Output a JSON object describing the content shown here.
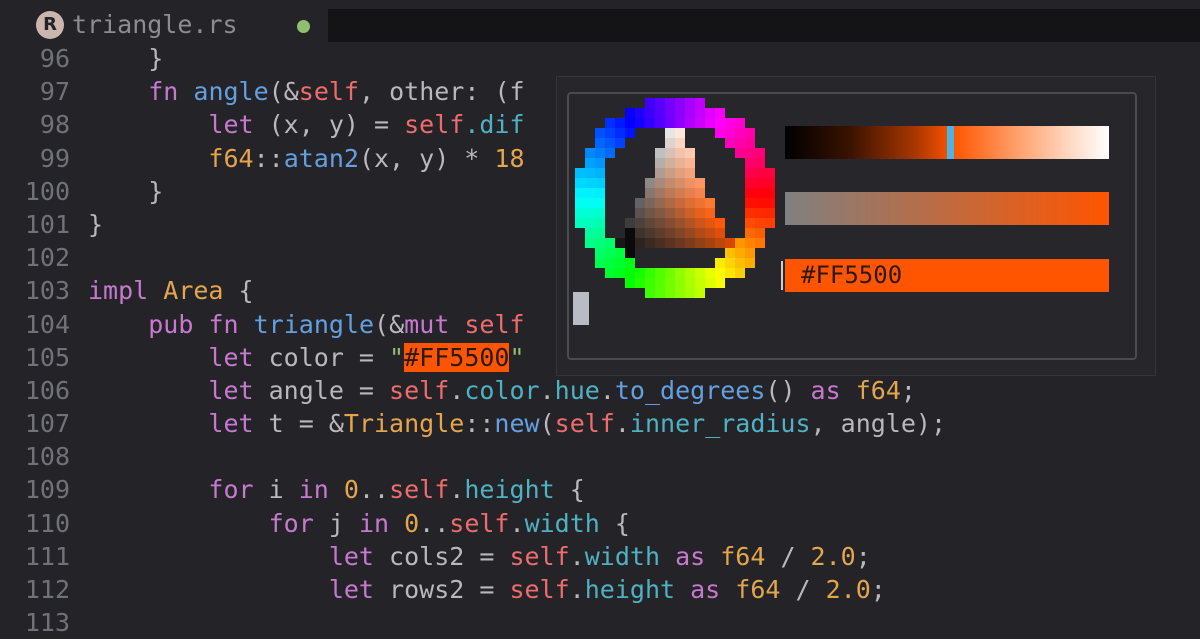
{
  "tab": {
    "icon": "rust-logo-icon",
    "icon_glyph": "R",
    "filename": "triangle.rs",
    "modified_dot_color": "#8fbf6f"
  },
  "picker": {
    "hex_value": "#FF5500",
    "current_color": "#ff5500",
    "brightness_marker_fraction": 0.5
  },
  "lines": [
    {
      "num": "96",
      "tokens": [
        {
          "t": "    }",
          "c": "op"
        }
      ]
    },
    {
      "num": "97",
      "tokens": [
        {
          "t": "    ",
          "c": "op"
        },
        {
          "t": "fn",
          "c": "kw"
        },
        {
          "t": " ",
          "c": "op"
        },
        {
          "t": "angle",
          "c": "fn"
        },
        {
          "t": "(&",
          "c": "op"
        },
        {
          "t": "self",
          "c": "slf"
        },
        {
          "t": ", other: (f",
          "c": "op"
        }
      ]
    },
    {
      "num": "98",
      "tokens": [
        {
          "t": "        ",
          "c": "op"
        },
        {
          "t": "let",
          "c": "kw"
        },
        {
          "t": " (x, y) = ",
          "c": "op"
        },
        {
          "t": "self",
          "c": "slf"
        },
        {
          "t": ".dif",
          "c": "fld"
        }
      ]
    },
    {
      "num": "99",
      "tokens": [
        {
          "t": "        ",
          "c": "op"
        },
        {
          "t": "f64",
          "c": "ty"
        },
        {
          "t": "::",
          "c": "op"
        },
        {
          "t": "atan2",
          "c": "fn"
        },
        {
          "t": "(x, y) * ",
          "c": "op"
        },
        {
          "t": "18",
          "c": "num"
        }
      ]
    },
    {
      "num": "100",
      "tokens": [
        {
          "t": "    }",
          "c": "op"
        }
      ]
    },
    {
      "num": "101",
      "tokens": [
        {
          "t": "}",
          "c": "op"
        }
      ]
    },
    {
      "num": "102",
      "tokens": []
    },
    {
      "num": "103",
      "tokens": [
        {
          "t": "impl",
          "c": "kw"
        },
        {
          "t": " ",
          "c": "op"
        },
        {
          "t": "Area",
          "c": "ty"
        },
        {
          "t": " {",
          "c": "op"
        }
      ]
    },
    {
      "num": "104",
      "tokens": [
        {
          "t": "    ",
          "c": "op"
        },
        {
          "t": "pub",
          "c": "kw"
        },
        {
          "t": " ",
          "c": "op"
        },
        {
          "t": "fn",
          "c": "kw"
        },
        {
          "t": " ",
          "c": "op"
        },
        {
          "t": "triangle",
          "c": "fn"
        },
        {
          "t": "(&",
          "c": "op"
        },
        {
          "t": "mut",
          "c": "kw"
        },
        {
          "t": " ",
          "c": "op"
        },
        {
          "t": "self",
          "c": "slf"
        }
      ]
    },
    {
      "num": "105",
      "tokens": [
        {
          "t": "        ",
          "c": "op"
        },
        {
          "t": "let",
          "c": "kw"
        },
        {
          "t": " color = ",
          "c": "op"
        },
        {
          "t": "\"",
          "c": "str"
        },
        {
          "t": "#FF5500",
          "c": "hl"
        },
        {
          "t": "\"",
          "c": "str"
        }
      ]
    },
    {
      "num": "106",
      "tokens": [
        {
          "t": "        ",
          "c": "op"
        },
        {
          "t": "let",
          "c": "kw"
        },
        {
          "t": " angle = ",
          "c": "op"
        },
        {
          "t": "self",
          "c": "slf"
        },
        {
          "t": ".",
          "c": "op"
        },
        {
          "t": "color",
          "c": "fld"
        },
        {
          "t": ".",
          "c": "op"
        },
        {
          "t": "hue",
          "c": "fld"
        },
        {
          "t": ".",
          "c": "op"
        },
        {
          "t": "to_degrees",
          "c": "fn"
        },
        {
          "t": "() ",
          "c": "op"
        },
        {
          "t": "as",
          "c": "kw"
        },
        {
          "t": " ",
          "c": "op"
        },
        {
          "t": "f64",
          "c": "ty"
        },
        {
          "t": ";",
          "c": "op"
        }
      ]
    },
    {
      "num": "107",
      "tokens": [
        {
          "t": "        ",
          "c": "op"
        },
        {
          "t": "let",
          "c": "kw"
        },
        {
          "t": " t = &",
          "c": "op"
        },
        {
          "t": "Triangle",
          "c": "ty"
        },
        {
          "t": "::",
          "c": "op"
        },
        {
          "t": "new",
          "c": "fn"
        },
        {
          "t": "(",
          "c": "op"
        },
        {
          "t": "self",
          "c": "slf"
        },
        {
          "t": ".",
          "c": "op"
        },
        {
          "t": "inner_radius",
          "c": "fld"
        },
        {
          "t": ", angle);",
          "c": "op"
        }
      ]
    },
    {
      "num": "108",
      "tokens": []
    },
    {
      "num": "109",
      "tokens": [
        {
          "t": "        ",
          "c": "op"
        },
        {
          "t": "for",
          "c": "kw"
        },
        {
          "t": " i ",
          "c": "op"
        },
        {
          "t": "in",
          "c": "kw"
        },
        {
          "t": " ",
          "c": "op"
        },
        {
          "t": "0",
          "c": "num"
        },
        {
          "t": "..",
          "c": "op"
        },
        {
          "t": "self",
          "c": "slf"
        },
        {
          "t": ".",
          "c": "op"
        },
        {
          "t": "height",
          "c": "fld"
        },
        {
          "t": " {",
          "c": "op"
        }
      ]
    },
    {
      "num": "110",
      "tokens": [
        {
          "t": "            ",
          "c": "op"
        },
        {
          "t": "for",
          "c": "kw"
        },
        {
          "t": " j ",
          "c": "op"
        },
        {
          "t": "in",
          "c": "kw"
        },
        {
          "t": " ",
          "c": "op"
        },
        {
          "t": "0",
          "c": "num"
        },
        {
          "t": "..",
          "c": "op"
        },
        {
          "t": "self",
          "c": "slf"
        },
        {
          "t": ".",
          "c": "op"
        },
        {
          "t": "width",
          "c": "fld"
        },
        {
          "t": " {",
          "c": "op"
        }
      ]
    },
    {
      "num": "111",
      "tokens": [
        {
          "t": "                ",
          "c": "op"
        },
        {
          "t": "let",
          "c": "kw"
        },
        {
          "t": " cols2 = ",
          "c": "op"
        },
        {
          "t": "self",
          "c": "slf"
        },
        {
          "t": ".",
          "c": "op"
        },
        {
          "t": "width",
          "c": "fld"
        },
        {
          "t": " ",
          "c": "op"
        },
        {
          "t": "as",
          "c": "kw"
        },
        {
          "t": " ",
          "c": "op"
        },
        {
          "t": "f64",
          "c": "ty"
        },
        {
          "t": " / ",
          "c": "op"
        },
        {
          "t": "2.0",
          "c": "num"
        },
        {
          "t": ";",
          "c": "op"
        }
      ]
    },
    {
      "num": "112",
      "tokens": [
        {
          "t": "                ",
          "c": "op"
        },
        {
          "t": "let",
          "c": "kw"
        },
        {
          "t": " rows2 = ",
          "c": "op"
        },
        {
          "t": "self",
          "c": "slf"
        },
        {
          "t": ".",
          "c": "op"
        },
        {
          "t": "height",
          "c": "fld"
        },
        {
          "t": " ",
          "c": "op"
        },
        {
          "t": "as",
          "c": "kw"
        },
        {
          "t": " ",
          "c": "op"
        },
        {
          "t": "f64",
          "c": "ty"
        },
        {
          "t": " / ",
          "c": "op"
        },
        {
          "t": "2.0",
          "c": "num"
        },
        {
          "t": ";",
          "c": "op"
        }
      ]
    },
    {
      "num": "113",
      "tokens": []
    }
  ]
}
